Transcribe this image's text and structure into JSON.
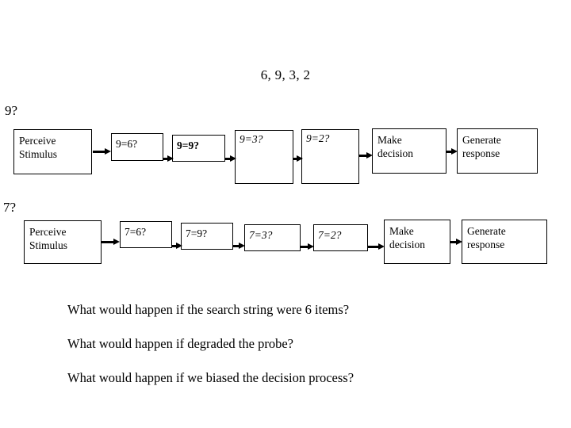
{
  "title": "6, 9, 3, 2",
  "rows": [
    {
      "label": "9?",
      "boxes": [
        {
          "text": "Perceive\nStimulus",
          "style": "plain"
        },
        {
          "text": "9=6?",
          "style": "plain"
        },
        {
          "text": "9=9?",
          "style": "bold"
        },
        {
          "text": "9=3?",
          "style": "italic"
        },
        {
          "text": "9=2?",
          "style": "italic"
        },
        {
          "text": "Make\ndecision",
          "style": "plain"
        },
        {
          "text": "Generate\nresponse",
          "style": "plain"
        }
      ]
    },
    {
      "label": "7?",
      "boxes": [
        {
          "text": "Perceive\nStimulus",
          "style": "plain"
        },
        {
          "text": "7=6?",
          "style": "plain"
        },
        {
          "text": "7=9?",
          "style": "plain"
        },
        {
          "text": "7=3?",
          "style": "italic"
        },
        {
          "text": "7=2?",
          "style": "italic"
        },
        {
          "text": "Make\ndecision",
          "style": "plain"
        },
        {
          "text": "Generate\nresponse",
          "style": "plain"
        }
      ]
    }
  ],
  "questions": [
    "What would happen if the search string were 6 items?",
    "What would happen if degraded the probe?",
    "What would happen if we biased the decision process?"
  ],
  "colors": {
    "background": "#ffffff",
    "ink": "#000000",
    "box_border": "#000000"
  }
}
